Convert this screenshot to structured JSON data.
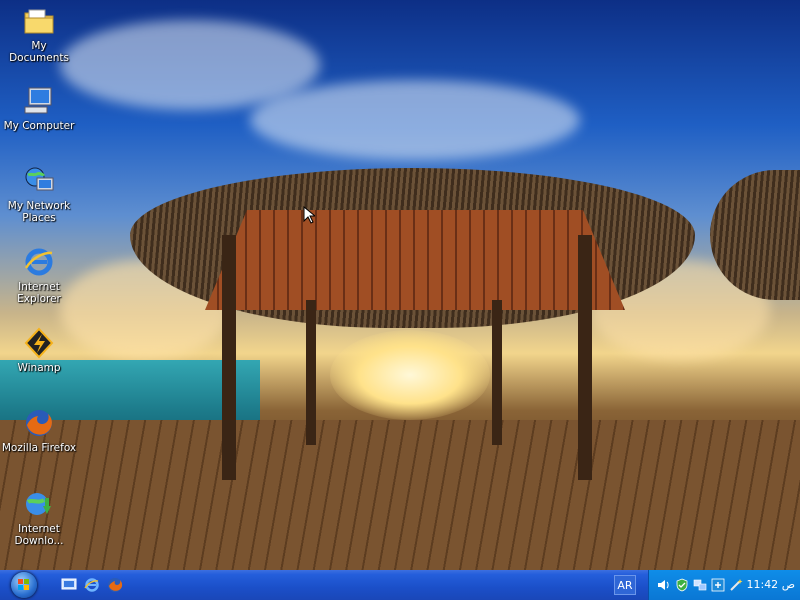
{
  "desktop_icons": [
    {
      "label": "My Documents",
      "icon": "folder-documents-icon"
    },
    {
      "label": "My Computer",
      "icon": "computer-icon"
    },
    {
      "label": "My Network\nPlaces",
      "icon": "network-places-icon"
    },
    {
      "label": "Internet\nExplorer",
      "icon": "internet-explorer-icon"
    },
    {
      "label": "Winamp",
      "icon": "winamp-icon"
    },
    {
      "label": "Mozilla Firefox",
      "icon": "firefox-icon"
    },
    {
      "label": "Internet\nDownlo...",
      "icon": "internet-download-manager-icon"
    }
  ],
  "taskbar": {
    "quick_launch": [
      "show-desktop-icon",
      "internet-explorer-icon",
      "firefox-icon"
    ],
    "language": "AR",
    "tray_icons": [
      "volume-icon",
      "security-shield-icon",
      "network-icon",
      "update-icon",
      "wand-icon"
    ],
    "clock": "11:42 ص"
  },
  "colors": {
    "taskbar": "#245edb",
    "tray": "#0f8de8"
  }
}
